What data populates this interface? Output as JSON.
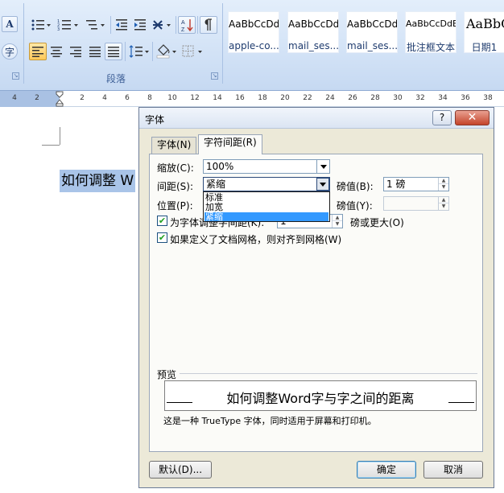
{
  "ribbon": {
    "paragraph_group_label": "段落",
    "style_gallery": [
      {
        "sample": "AaBbCcDd",
        "name": "apple-co..."
      },
      {
        "sample": "AaBbCcDd",
        "name": "mail_ses..."
      },
      {
        "sample": "AaBbCcDd",
        "name": "mail_ses..."
      },
      {
        "sample": "AaBbCcDdE",
        "name": "批注框文本"
      },
      {
        "sample": "AaBbC",
        "name": "日期1"
      }
    ]
  },
  "ruler": {
    "ticks": [
      "4",
      "2",
      "2",
      "4",
      "6",
      "8",
      "10",
      "12",
      "14",
      "16",
      "18",
      "20",
      "22",
      "24",
      "26",
      "28",
      "30",
      "32",
      "34",
      "36",
      "38"
    ]
  },
  "document": {
    "selected_text": "如何调整 W"
  },
  "dialog": {
    "title": "字体",
    "help_label": "?",
    "close_label": "✕",
    "tabs": [
      {
        "label": "字体(N)",
        "active": false
      },
      {
        "label": "字符间距(R)",
        "active": true
      }
    ],
    "scale_label": "缩放(C):",
    "scale_value": "100%",
    "spacing_label": "间距(S):",
    "spacing_value": "紧缩",
    "spacing_options": [
      "标准",
      "加宽",
      "紧缩"
    ],
    "spacing_selected": "紧缩",
    "spacing_by_label": "磅值(B):",
    "spacing_by_value": "1 磅",
    "position_label": "位置(P):",
    "position_value": "",
    "position_by_label": "磅值(Y):",
    "position_by_value": "",
    "kerning_label": "为字体调整字间距(K):",
    "kerning_value": "1",
    "kerning_suffix": "磅或更大(O)",
    "kerning_checked": true,
    "grid_label": "如果定义了文档网格，则对齐到网格(W)",
    "grid_checked": true,
    "preview_label": "预览",
    "preview_text": "如何调整Word字与字之间的距离",
    "preview_note": "这是一种 TrueType 字体，同时适用于屏幕和打印机。",
    "default_button": "默认(D)...",
    "ok_button": "确定",
    "cancel_button": "取消"
  }
}
